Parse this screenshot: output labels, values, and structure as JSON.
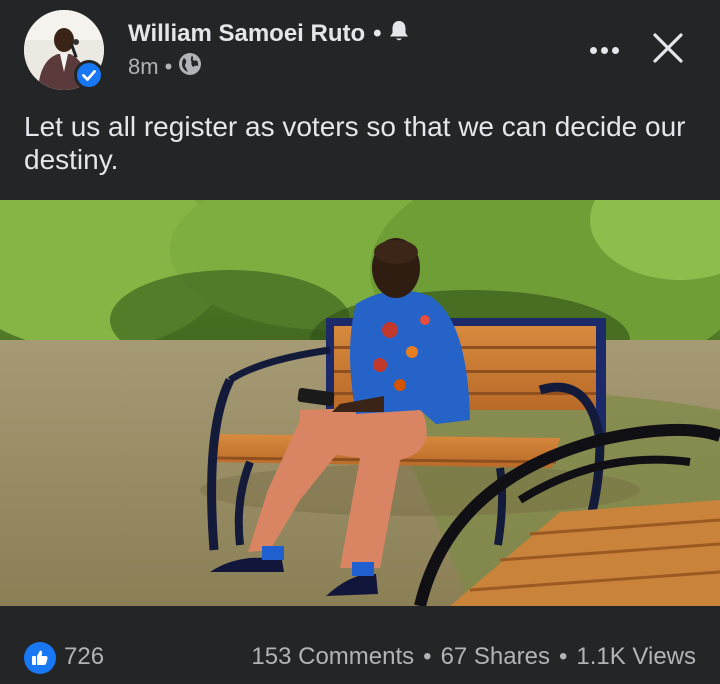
{
  "post": {
    "author_name": "William Samoei Ruto",
    "time_ago": "8m",
    "caption": "Let us all register as voters so that we can decide our destiny."
  },
  "icons": {
    "notification": "bell-icon",
    "privacy": "globe-icon",
    "verified": "verified-badge-icon",
    "more": "more-options-icon",
    "close": "close-icon",
    "like": "thumbs-up-icon"
  },
  "stats": {
    "likes": "726",
    "comments": "153 Comments",
    "shares": "67 Shares",
    "views": "1.1K Views",
    "separator": "•"
  },
  "colors": {
    "background": "#242526",
    "text_primary": "#e4e6eb",
    "text_secondary": "#b0b3b8",
    "accent_blue": "#1877f2"
  }
}
